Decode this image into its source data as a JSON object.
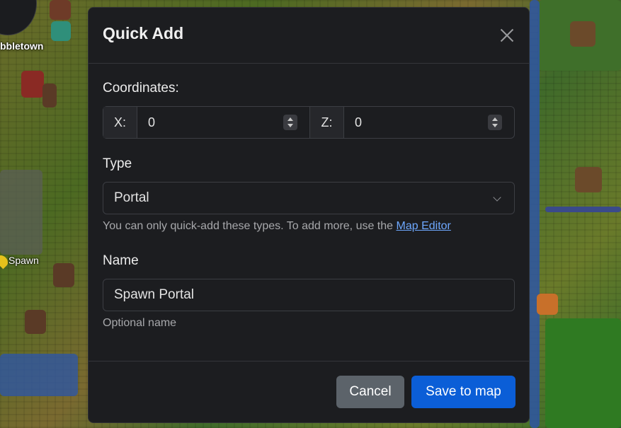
{
  "map": {
    "town_label": "bbletown",
    "spawn_label": "Spawn"
  },
  "modal": {
    "title": "Quick Add",
    "coordinates": {
      "label": "Coordinates:",
      "x_label": "X:",
      "x_value": "0",
      "z_label": "Z:",
      "z_value": "0"
    },
    "type": {
      "label": "Type",
      "selected": "Portal",
      "help_prefix": "You can only quick-add these types. To add more, use the ",
      "help_link": "Map Editor"
    },
    "name": {
      "label": "Name",
      "value": "Spawn Portal",
      "help": "Optional name"
    },
    "footer": {
      "cancel_label": "Cancel",
      "save_label": "Save to map"
    }
  },
  "colors": {
    "modal_bg": "#1c1d20",
    "primary": "#0b5ed7",
    "secondary": "#5c636a",
    "link": "#6ea8fe"
  }
}
